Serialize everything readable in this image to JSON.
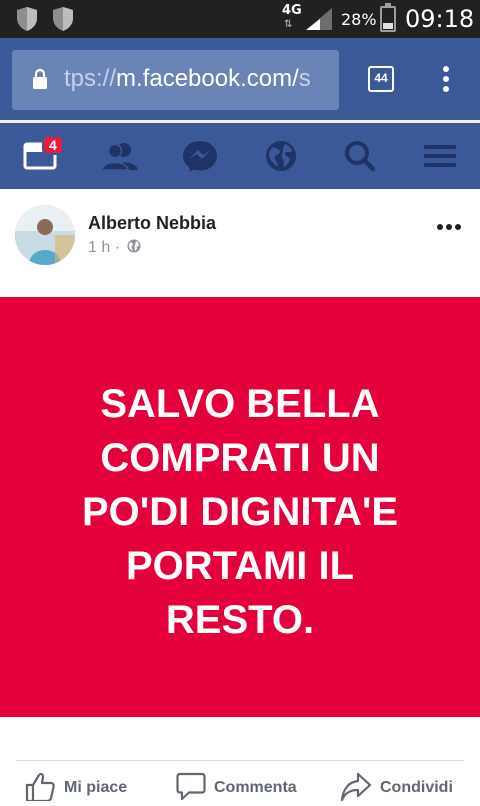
{
  "status_bar": {
    "network": "4G",
    "battery": "28%",
    "battery_level": 0.28,
    "time": "09:18"
  },
  "browser": {
    "url_prefix": "tps://",
    "url_host": "m.facebook.com/",
    "url_tail": "s",
    "tab_count": "44"
  },
  "fb_nav": {
    "items": [
      "news-feed",
      "friend-requests",
      "messages",
      "notifications",
      "search",
      "menu"
    ],
    "feed_badge": "4"
  },
  "post": {
    "author": "Alberto Nebbia",
    "time": "1 h ·",
    "banner_text": "SALVO BELLA COMPRATI UN PO'DI DIGNITA'E PORTAMI IL RESTO.",
    "banner_color": "#e4003b"
  },
  "actions": {
    "like": "Mi piace",
    "comment": "Commenta",
    "share": "Condividi"
  },
  "colors": {
    "facebook_blue": "#3b5998",
    "status_bar": "#212121"
  }
}
